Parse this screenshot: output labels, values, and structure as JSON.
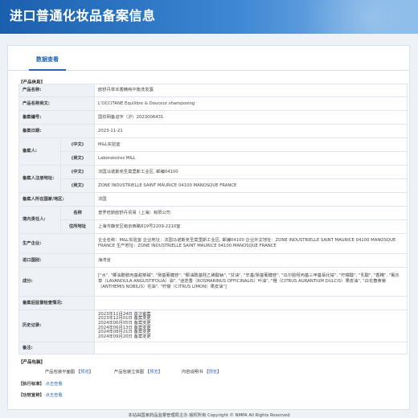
{
  "header": {
    "title": "进口普通化妆品备案信息"
  },
  "tabs": {
    "active": "数据查看"
  },
  "product_info": {
    "heading": "【产品信息】",
    "name_cn_label": "产品名称:",
    "name_cn": "欧舒丹草本香精纯平衡洗发露",
    "name_en_label": "产品名称英文:",
    "name_en": "L'OCCITANE Equilibre & Douceur shampooing",
    "reg_no_label": "备案编号:",
    "reg_no": "国妆网备进字（沪）2023006431",
    "date_label": "备案日期:",
    "date": "2023-11-21",
    "registrant_label": "备案人:",
    "cn_tag": "(中文)",
    "en_tag": "(英文)",
    "registrant_cn": "M&L实验室",
    "registrant_en": "Laboratoires M&L",
    "reg_addr_label": "备案人注册地址:",
    "reg_addr_cn": "法国马诺斯克圣莫里斯工业区, 邮编04100",
    "reg_addr_en": "ZONE INDUSTRIELLE SAINT MAURICE 04100 MANOSQUE FRANCE",
    "country_label": "备案人所在国家/地区:",
    "country": "法国",
    "agent_label": "境内责任人:",
    "agent_name_tag": "名称",
    "agent_addr_tag": "住所地址",
    "agent_name": "普罗旺斯欧舒丹贸易（上海）有限公司",
    "agent_addr": "上海市静安区南京西路819号2209-2210室",
    "manufacturer_label": "生产企业:",
    "manufacturer": "企业名称：M&L实验室 企业地址：法国马诺斯克圣莫里斯工业区, 邮编04100 企业外文地址：ZONE INDUSTRIELLE SAINT MAURICE 04100 MANOSQUE FRANCE 生产地址：ZONE INDUSTRIELLE SAINT MAURICE 04100 MANOSQUE FRANCE",
    "import_country_label": "进口国别:",
    "import_country": "海湾省",
    "ingredients_label": "成分:",
    "ingredients": "[\"水\", \"椰油酰胺丙基甜菜碱\", \"癸基葡糖苷\", \"椰油酰基羟乙磺酸钠\", \"甘油\", \"辛基/癸基葡糖苷\", \"瓜尔胶羟丙基三甲基氯化铵\", \"柠檬酸\", \"乳酸\", \"香精\", \"薰衣草（LAVANDULA ANGUSTIFOLIA）油\", \"迷迭香（ROSMARINUS OFFICINALIS）叶油\", \"橙（CITRUS AURANTIUM DULCIS）果皮油\", \"白花春黄菊（ANTHEMIS NOBILIS）花油\", \"柠檬（CITRUS LIMON）果皮油\"]",
    "postmarket_label": "备案后监督检查情况:",
    "postmarket": "",
    "history_label": "历史记录:",
    "history": [
      "2023年11月24日 首次备案",
      "2023年12月01日 备案变更",
      "2024年06月05日 备案变更",
      "2024年06月13日 备案变更",
      "2024年08月21日 备案变更",
      "2024年09月20日 备案变更"
    ],
    "remark_label": "备注:",
    "remark": ""
  },
  "packaging": {
    "heading": "【产品包装】",
    "plan_label": "产品包装平面图",
    "stereo_label": "产品包装立体图",
    "label_label": "内容说明书",
    "preview": "预览"
  },
  "standard": {
    "heading": "【执行标准】",
    "link": "点击查看"
  },
  "efficacy": {
    "heading": "【功效宣称】",
    "link": "点击查看"
  },
  "footer": {
    "text": "本站由国家药品监督管理局主办 版权所有 Copyright © NMPA All Rights Reserved"
  }
}
